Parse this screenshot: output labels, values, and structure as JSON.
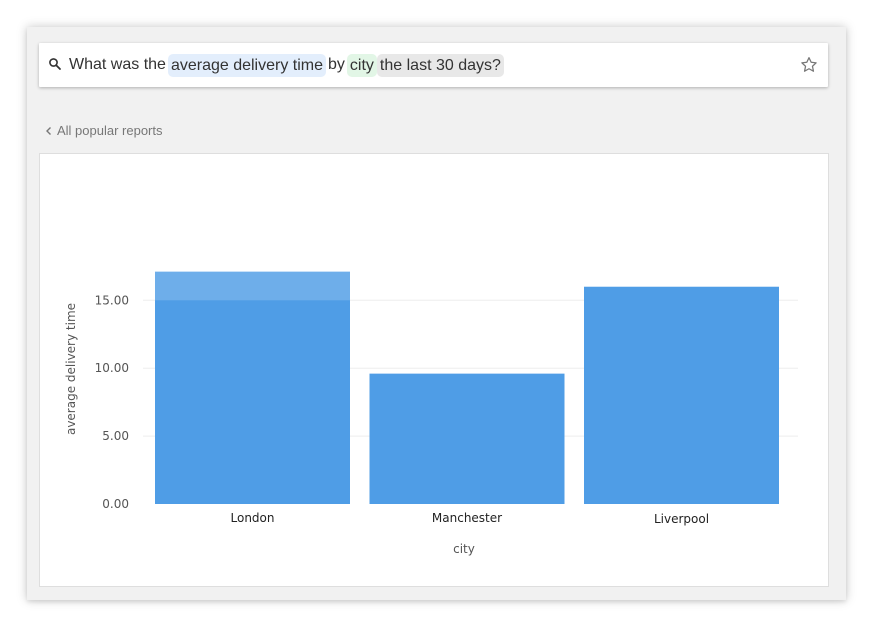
{
  "search": {
    "query_parts": [
      {
        "text": "What was the",
        "kind": "plain"
      },
      {
        "text": "average delivery time",
        "kind": "measure"
      },
      {
        "text": "by",
        "kind": "plain"
      },
      {
        "text": "city",
        "kind": "dimension"
      },
      {
        "text": "the last 30 days?",
        "kind": "time"
      }
    ],
    "icon": "search-icon",
    "star_icon": "star-outline-icon"
  },
  "nav": {
    "back_label": "All popular reports",
    "back_icon": "chevron-left-icon"
  },
  "colors": {
    "bar": "#4f9de6",
    "bar_highlight": "#6eaeea",
    "measure_chip": "#e3eefc",
    "dimension_chip": "#e2f6e6",
    "time_chip": "#e8e8e8"
  },
  "chart_data": {
    "type": "bar",
    "categories": [
      "London",
      "Manchester",
      "Liverpool"
    ],
    "values": [
      17.1,
      9.6,
      16.0
    ],
    "xlabel": "city",
    "ylabel": "average delivery time",
    "yticks": [
      "0.00",
      "5.00",
      "10.00",
      "15.00"
    ],
    "ylim": [
      0,
      17.1
    ],
    "grid": true,
    "legend": "none"
  }
}
